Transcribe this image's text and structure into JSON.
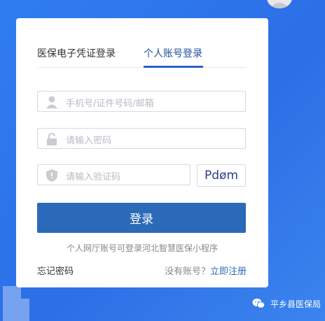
{
  "login": {
    "tabs": [
      {
        "label": "医保电子凭证登录"
      },
      {
        "label": "个人账号登录"
      }
    ],
    "account_placeholder": "手机号/证件号码/邮箱",
    "password_placeholder": "请输入密码",
    "captcha_placeholder": "请输入验证码",
    "captcha_text": "Pdøm",
    "submit_label": "登录",
    "hint_text": "个人网厅账号可登录河北智慧医保小程序",
    "forgot_label": "忘记密码",
    "no_account_text": "没有账号？",
    "register_label": "立即注册"
  },
  "watermark": {
    "text": "平乡县医保局"
  },
  "colors": {
    "background": "#2f7df0",
    "primary": "#2a6ab8",
    "active_tab": "#1f4fa0"
  }
}
